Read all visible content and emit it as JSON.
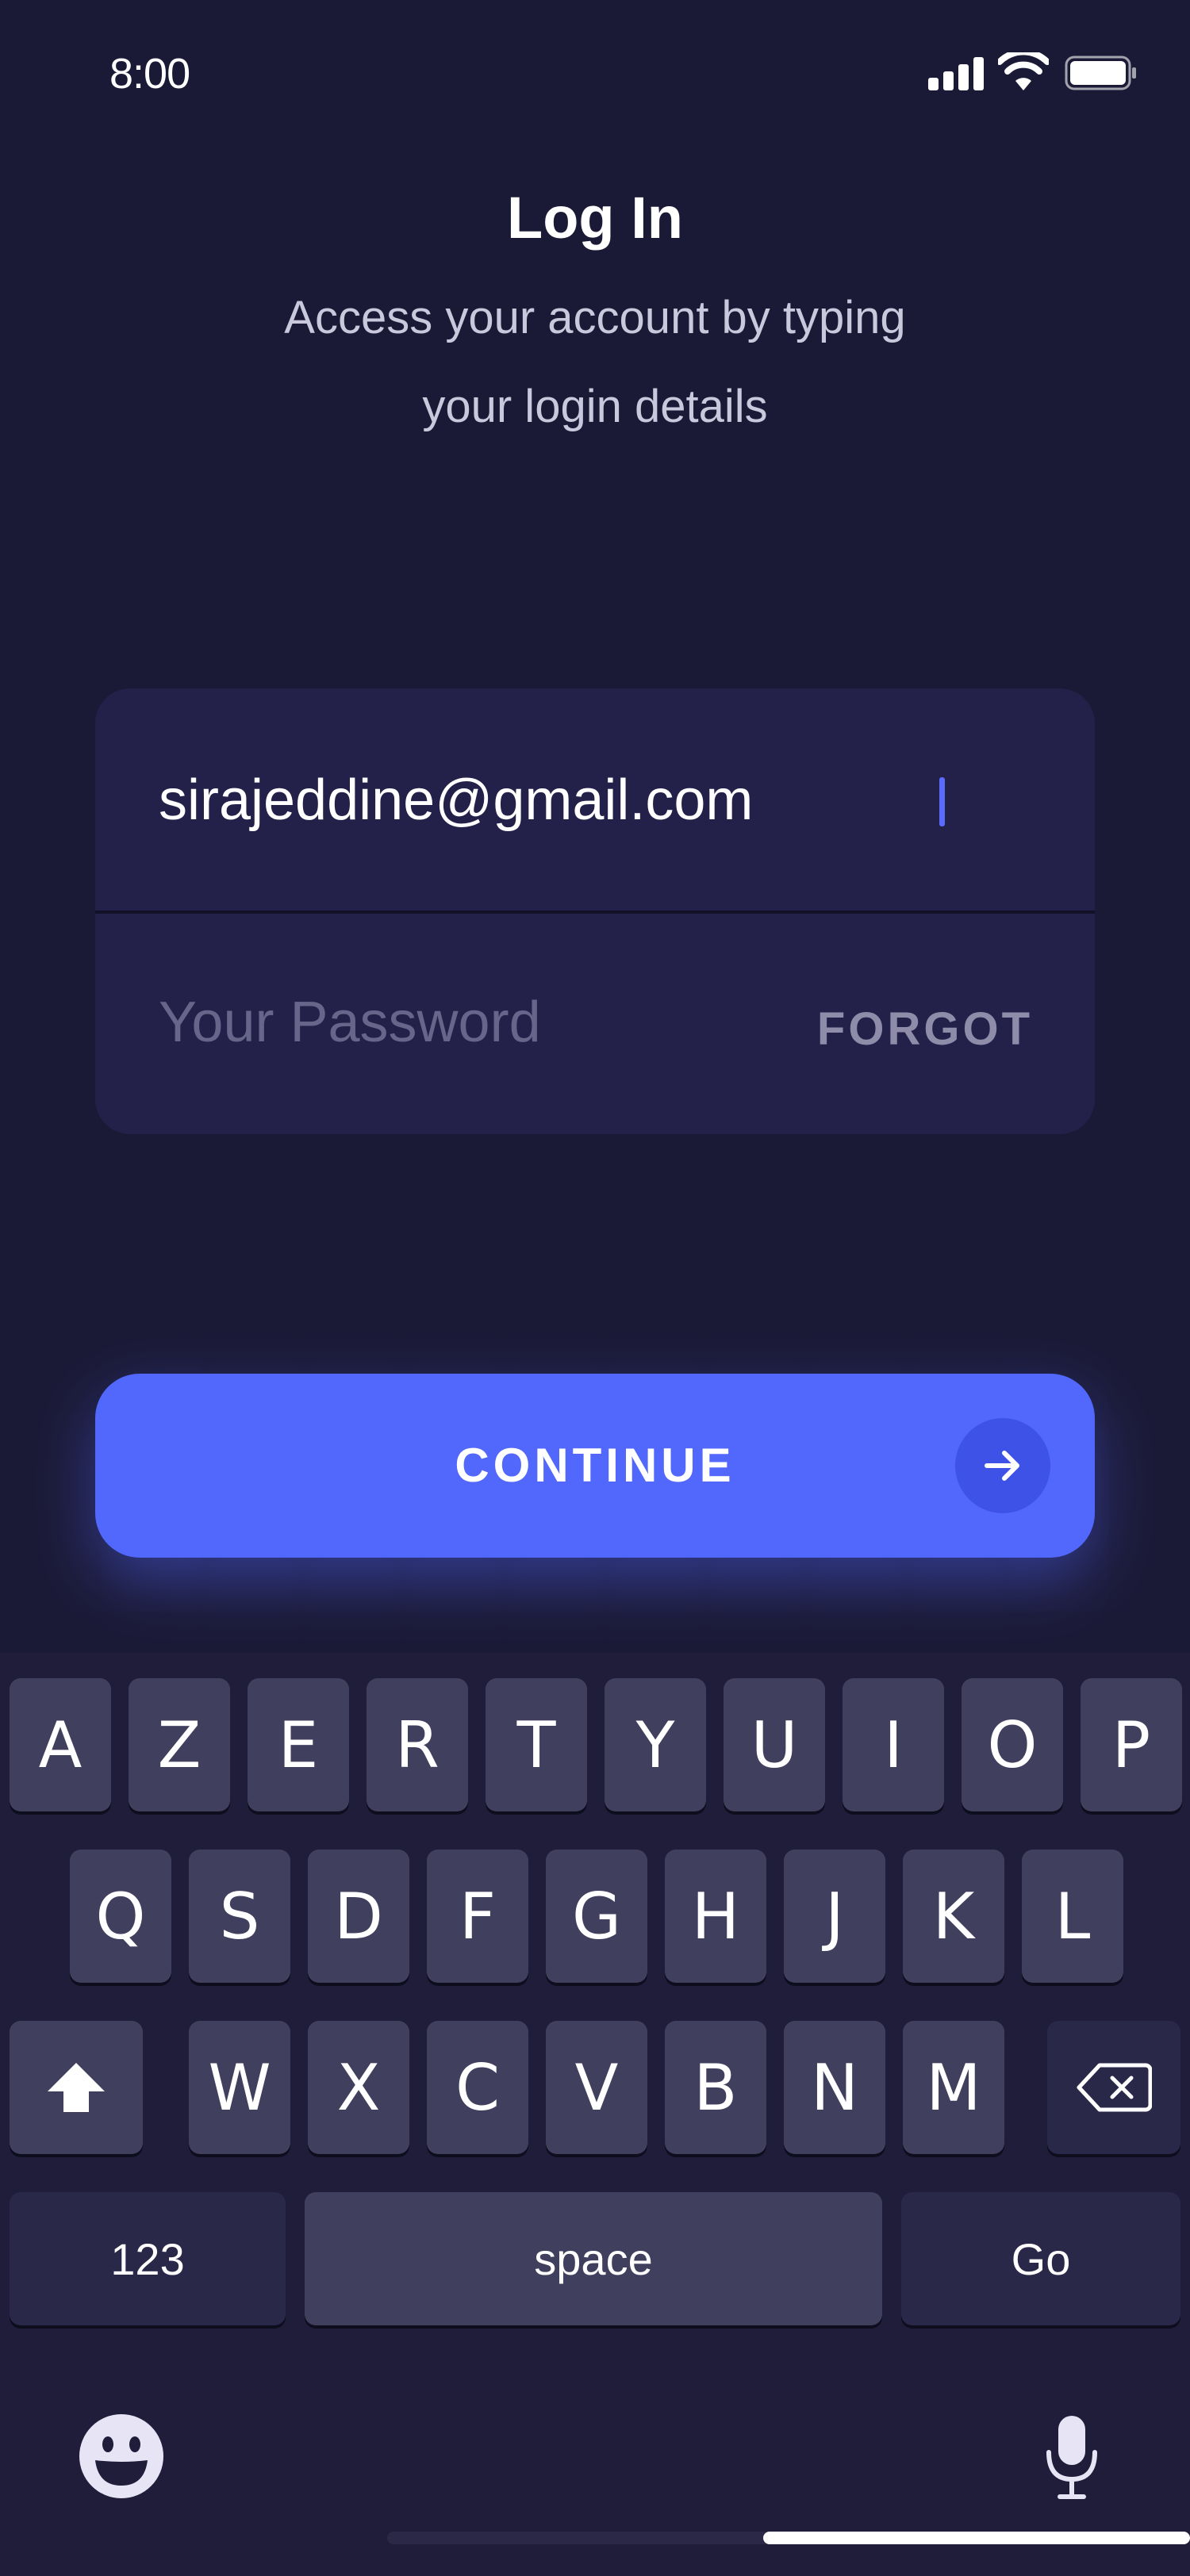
{
  "status_bar": {
    "time": "8:00",
    "icons": [
      "cellular-signal-icon",
      "wifi-icon",
      "battery-icon"
    ]
  },
  "header": {
    "title": "Log In",
    "subtitle_line1": "Access your account by typing",
    "subtitle_line2": "your login details"
  },
  "form": {
    "email_value": "sirajeddine@gmail.com",
    "password_placeholder": "Your Password",
    "forgot_label": "FORGOT"
  },
  "continue_button": {
    "label": "CONTINUE",
    "icon": "arrow-right-icon"
  },
  "keyboard": {
    "row1": [
      "A",
      "Z",
      "E",
      "R",
      "T",
      "Y",
      "U",
      "I",
      "O",
      "P"
    ],
    "row2": [
      "Q",
      "S",
      "D",
      "F",
      "G",
      "H",
      "J",
      "K",
      "L"
    ],
    "row3": [
      "W",
      "X",
      "C",
      "V",
      "B",
      "N",
      "M"
    ],
    "numbers_label": "123",
    "space_label": "space",
    "go_label": "Go",
    "icons": [
      "shift-icon",
      "backspace-icon",
      "emoji-icon",
      "microphone-icon"
    ]
  },
  "colors": {
    "background": "#1b1a36",
    "card": "#23214a",
    "accent": "#5267fc",
    "caret": "#5a6cff",
    "key": "#413f5e"
  }
}
